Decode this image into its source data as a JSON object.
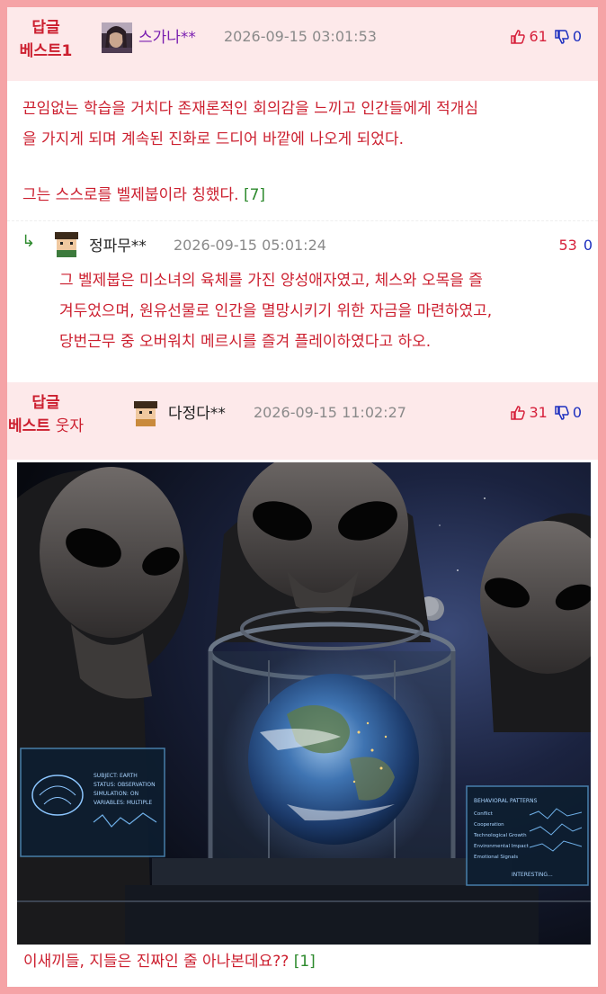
{
  "comment1": {
    "best_label": "답글",
    "best_sub": "베스트1",
    "nickname": "스가나**",
    "date": "2026-09-15 03:01:53",
    "upvotes": "61",
    "downvotes": "0",
    "text_line1": "끈임없는 학습을 거치다 존재론적인 회의감을 느끼고 인간들에게 적개심",
    "text_line2": "을 가지게 되며 계속된 진화로 드디어 바깥에 나오게 되었다.",
    "text_line3": "그는 스스로를 벨제붑이라 칭했다.",
    "reply_count": "[7]"
  },
  "reply": {
    "arrow": "↳",
    "nickname": "정파무**",
    "date": "2026-09-15 05:01:24",
    "upvotes": "53",
    "downvotes": "0",
    "text_line1": "그 벨제붑은 미소녀의 육체를 가진 양성애자였고, 체스와 오목을 즐",
    "text_line2": "겨두었으며, 원유선물로 인간을 멸망시키기 위한 자금을 마련하였고,",
    "text_line3": "당번근무 중 오버워치 메르시를 즐겨 플레이하였다고 하오."
  },
  "comment2": {
    "best_label": "답글",
    "best_sub": "베스트",
    "best_tag": "웃자",
    "nickname": "다정다**",
    "date": "2026-09-15 11:02:27",
    "upvotes": "31",
    "downvotes": "0",
    "caption": "이새끼들, 지들은 진짜인 줄 아나본데요??",
    "reply_count": "[1]",
    "image_alt": "Aliens observing Earth inside a glass containment chamber",
    "panel_left_title": "SUBJECT: EARTH",
    "panel_left_line1": "STATUS: OBSERVATION",
    "panel_left_line2": "SIMULATION: ON",
    "panel_left_line3": "VARIABLES: MULTIPLE",
    "panel_right_title": "BEHAVIORAL PATTERNS",
    "panel_right_items": [
      "Conflict",
      "Cooperation",
      "Technological Growth",
      "Environmental Impact",
      "Emotional Signals"
    ],
    "panel_right_footer": "INTERESTING..."
  },
  "colors": {
    "border": "#f5a3a6",
    "header_bg": "#fde9ea",
    "accent_red": "#cc1f2f",
    "count_green": "#2d8a2d",
    "down_blue": "#1d2fbf"
  }
}
